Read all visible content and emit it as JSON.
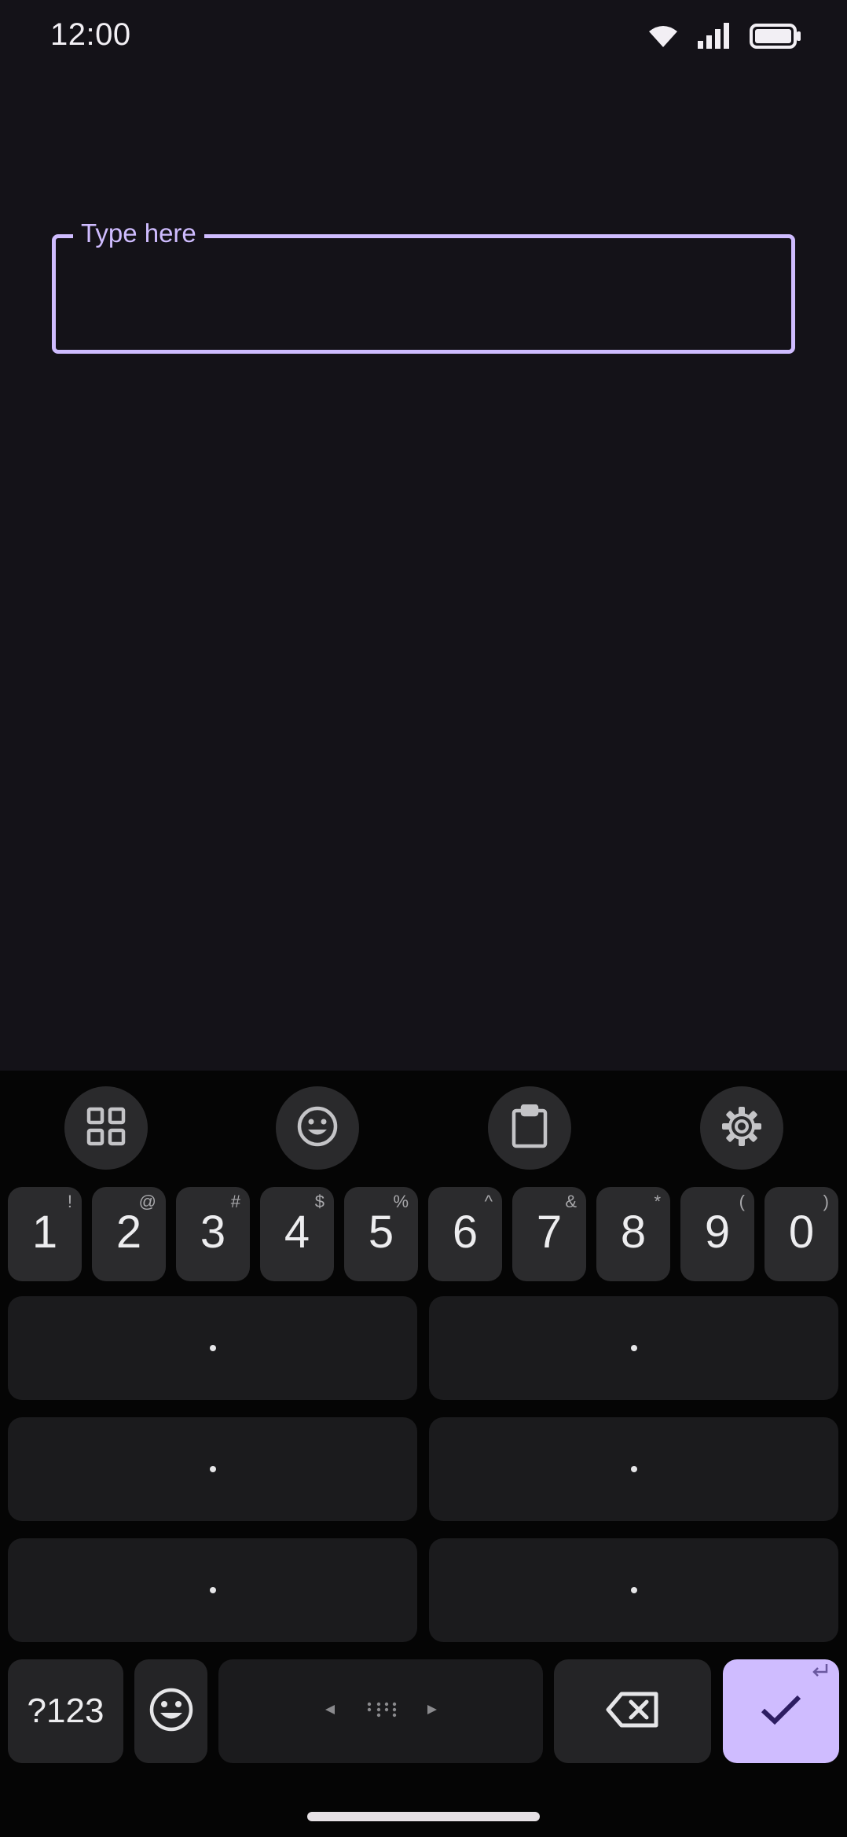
{
  "status_bar": {
    "time": "12:00",
    "icons": [
      "wifi-icon",
      "cellular-signal-icon",
      "battery-icon"
    ]
  },
  "text_field": {
    "label": "Type here",
    "value": ""
  },
  "keyboard": {
    "toolbar": [
      "apps-grid-icon",
      "emoji-icon",
      "clipboard-icon",
      "settings-gear-icon"
    ],
    "number_row": [
      {
        "key": "1",
        "hint": "!"
      },
      {
        "key": "2",
        "hint": "@"
      },
      {
        "key": "3",
        "hint": "#"
      },
      {
        "key": "4",
        "hint": "$"
      },
      {
        "key": "5",
        "hint": "%"
      },
      {
        "key": "6",
        "hint": "^"
      },
      {
        "key": "7",
        "hint": "&"
      },
      {
        "key": "8",
        "hint": "*"
      },
      {
        "key": "9",
        "hint": "("
      },
      {
        "key": "0",
        "hint": ")"
      }
    ],
    "symbols_label": "?123",
    "space_icon": "braille-space-icon",
    "backspace_icon": "backspace-icon",
    "enter_icon": "check-icon",
    "enter_hint_icon": "return-arrow-icon"
  },
  "colors": {
    "background": "#141218",
    "accent": "#cfbcff",
    "keyboard_bg": "#050505",
    "key_bg": "#2b2b2d"
  }
}
